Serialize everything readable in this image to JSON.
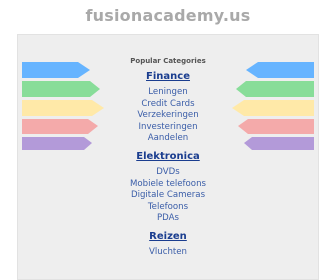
{
  "site": {
    "title": "fusionacademy.us"
  },
  "popular_label": "Popular Categories",
  "categories": [
    {
      "title": "Finance",
      "links": [
        "Leningen",
        "Credit Cards",
        "Verzekeringen",
        "Investeringen",
        "Aandelen"
      ]
    },
    {
      "title": "Elektronica",
      "links": [
        "DVDs",
        "Mobiele telefoons",
        "Digitale Cameras",
        "Telefoons",
        "PDAs"
      ]
    },
    {
      "title": "Reizen",
      "links": [
        "Vluchten"
      ]
    }
  ],
  "colors": {
    "title_gray": "#a9a9a9",
    "link_blue": "#3a5da8",
    "heading_blue": "#1a3d8f",
    "stripe_blue": "#66b4ff",
    "stripe_green": "#88dd99",
    "stripe_yellow": "#ffe9a8",
    "stripe_pink": "#f4aaaa",
    "stripe_purple": "#b39ad9"
  }
}
